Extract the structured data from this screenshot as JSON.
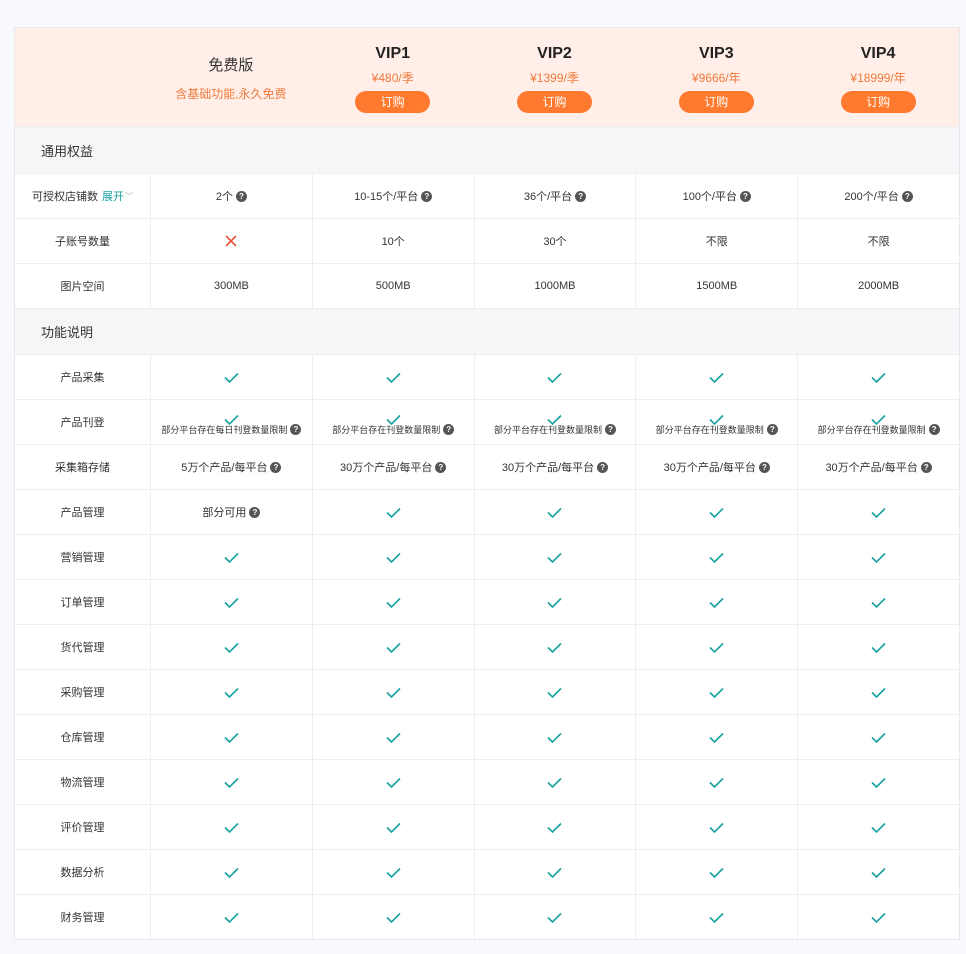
{
  "colors": {
    "accent": "#ff7a2f",
    "check": "#17a2a0",
    "cross": "#e4543d"
  },
  "plans": {
    "free": {
      "name": "免费版",
      "desc": "含基础功能,永久免费"
    },
    "vip1": {
      "name": "VIP1",
      "price": "¥480/季",
      "buy": "订购"
    },
    "vip2": {
      "name": "VIP2",
      "price": "¥1399/季",
      "buy": "订购"
    },
    "vip3": {
      "name": "VIP3",
      "price": "¥9666/年",
      "buy": "订购"
    },
    "vip4": {
      "name": "VIP4",
      "price": "¥18999/年",
      "buy": "订购"
    }
  },
  "sections": {
    "general": "通用权益",
    "features": "功能说明"
  },
  "general_rows": {
    "stores": {
      "label": "可授权店铺数",
      "expand": "展开",
      "free": "2个",
      "vip1": "10-15个/平台",
      "vip2": "36个/平台",
      "vip3": "100个/平台",
      "vip4": "200个/平台"
    },
    "subaccounts": {
      "label": "子账号数量",
      "vip1": "10个",
      "vip2": "30个",
      "vip3": "不限",
      "vip4": "不限"
    },
    "images": {
      "label": "图片空间",
      "free": "300MB",
      "vip1": "500MB",
      "vip2": "1000MB",
      "vip3": "1500MB",
      "vip4": "2000MB"
    }
  },
  "feature_rows": {
    "collect": {
      "label": "产品采集"
    },
    "publish": {
      "label": "产品刊登",
      "free_note": "部分平台存在每日刊登数量限制",
      "vip_note": "部分平台存在刊登数量限制"
    },
    "storage": {
      "label": "采集箱存储",
      "free": "5万个产品/每平台",
      "vip": "30万个产品/每平台"
    },
    "product_mgmt": {
      "label": "产品管理",
      "free": "部分可用"
    },
    "marketing": {
      "label": "营销管理"
    },
    "orders": {
      "label": "订单管理"
    },
    "forwarder": {
      "label": "货代管理"
    },
    "purchase": {
      "label": "采购管理"
    },
    "warehouse": {
      "label": "仓库管理"
    },
    "logistics": {
      "label": "物流管理"
    },
    "reviews": {
      "label": "评价管理"
    },
    "analytics": {
      "label": "数据分析"
    },
    "finance": {
      "label": "财务管理"
    }
  }
}
